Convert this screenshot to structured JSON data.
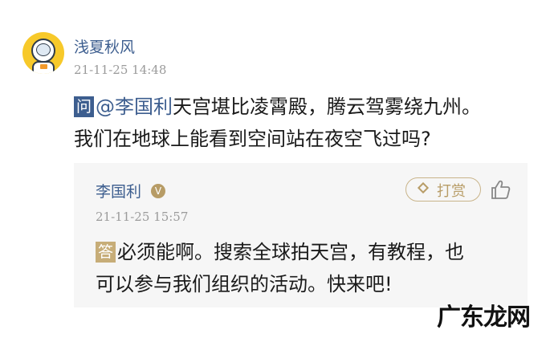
{
  "post": {
    "username": "浅夏秋风",
    "time": "21-11-25 14:48",
    "question_tag": "问",
    "mention": "@李国利",
    "line1_rest": "天宫堪比凌霄殿，腾云驾雾绕九州。",
    "line2": "我们在地球上能看到空间站在夜空飞过吗?"
  },
  "reply": {
    "name": "李国利",
    "verified_icon": "v-verified-icon",
    "tip_label": "打赏",
    "time": "21-11-25 15:57",
    "answer_tag": "答",
    "line1_rest": "必须能啊。搜索全球拍天宫，有教程，也",
    "line2": "可以参与我们组织的活动。快来吧!"
  },
  "watermark": "广东龙网",
  "colors": {
    "link_blue": "#3d5e8f",
    "gold": "#c7ad78",
    "reply_bg": "#f6f6f6"
  }
}
